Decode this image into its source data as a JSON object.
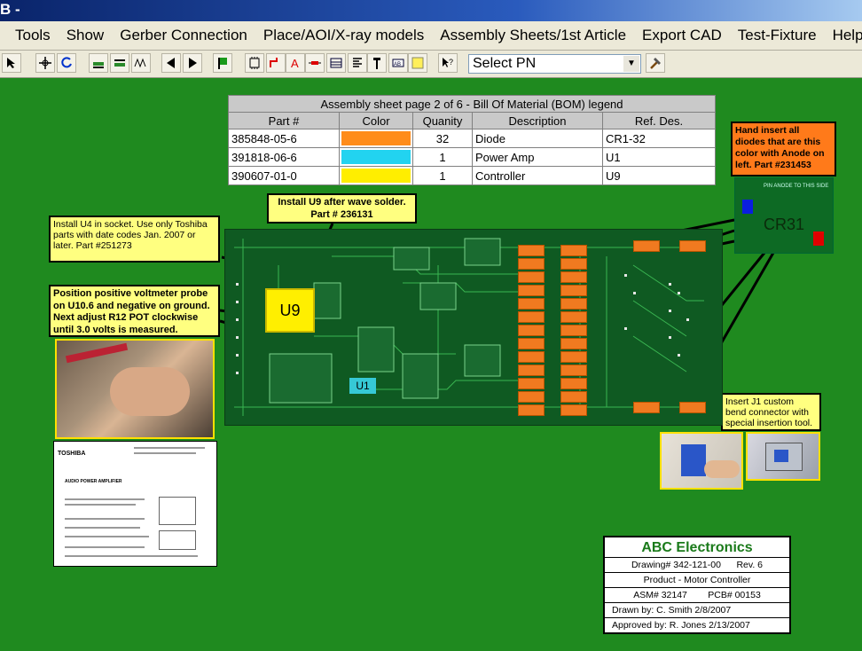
{
  "window": {
    "title": "B -"
  },
  "menu": [
    "Tools",
    "Show",
    "Gerber Connection",
    "Place/AOI/X-ray models",
    "Assembly Sheets/1st Article",
    "Export CAD",
    "Test-Fixture",
    "Help"
  ],
  "toolbar": {
    "icons": [
      "select-arrow-icon",
      "move-icon",
      "rotate-icon",
      "layer-top-icon",
      "layer-bottom-icon",
      "waveform-icon",
      "prev-icon",
      "next-icon",
      "flag-icon",
      "part-icon",
      "route-icon",
      "text-a-icon",
      "resistor-icon",
      "grid-icon",
      "list-icon",
      "probe-icon",
      "label-icon",
      "note-icon",
      "help-cursor-icon",
      "hammer-icon"
    ],
    "select_pn": "Select PN"
  },
  "bom": {
    "caption": "Assembly sheet page 2 of 6 - Bill Of Material (BOM) legend",
    "headers": [
      "Part #",
      "Color",
      "Quanity",
      "Description",
      "Ref. Des."
    ],
    "rows": [
      {
        "part": "385848-05-6",
        "color": "#ff8c1a",
        "qty": "32",
        "desc": "Diode",
        "ref": "CR1-32"
      },
      {
        "part": "391818-06-6",
        "color": "#22d3f0",
        "qty": "1",
        "desc": "Power Amp",
        "ref": "U1"
      },
      {
        "part": "390607-01-0",
        "color": "#ffee00",
        "qty": "1",
        "desc": "Controller",
        "ref": "U9"
      }
    ]
  },
  "notes": {
    "u9": "Install U9 after wave solder.\nPart # 236131",
    "u4": "Install U4 in socket. Use only Toshiba parts with date codes Jan. 2007 or later. Part #251273",
    "probe": "Position positive voltmeter probe on U10.6 and negative on ground. Next adjust R12 POT clockwise until 3.0 volts is measured.",
    "diodes": "Hand insert all diodes that are this color with Anode on left.  Part #231453",
    "j1": "Insert J1 custom bend connector with special insertion tool."
  },
  "pcb": {
    "u9_label": "U9",
    "u1_label": "U1",
    "cr31_label": "CR31",
    "cr31_pin_text": "PIN ANODE TO THIS SIDE"
  },
  "datasheet": {
    "brand": "TOSHIBA",
    "heading": "AUDIO POWER AMPLIFIER"
  },
  "titleblock": {
    "company": "ABC Electronics",
    "drawing": "Drawing# 342-121-00",
    "rev": "Rev. 6",
    "product": "Product - Motor Controller",
    "asm": "ASM# 32147",
    "pcb": "PCB# 00153",
    "drawn": "Drawn by: C. Smith  2/8/2007",
    "approved": "Approved by: R. Jones  2/13/2007"
  },
  "colors": {
    "background": "#1f8a1f",
    "note": "#ffff80",
    "diode": "#f07a20",
    "company": "#1a7a1a"
  }
}
